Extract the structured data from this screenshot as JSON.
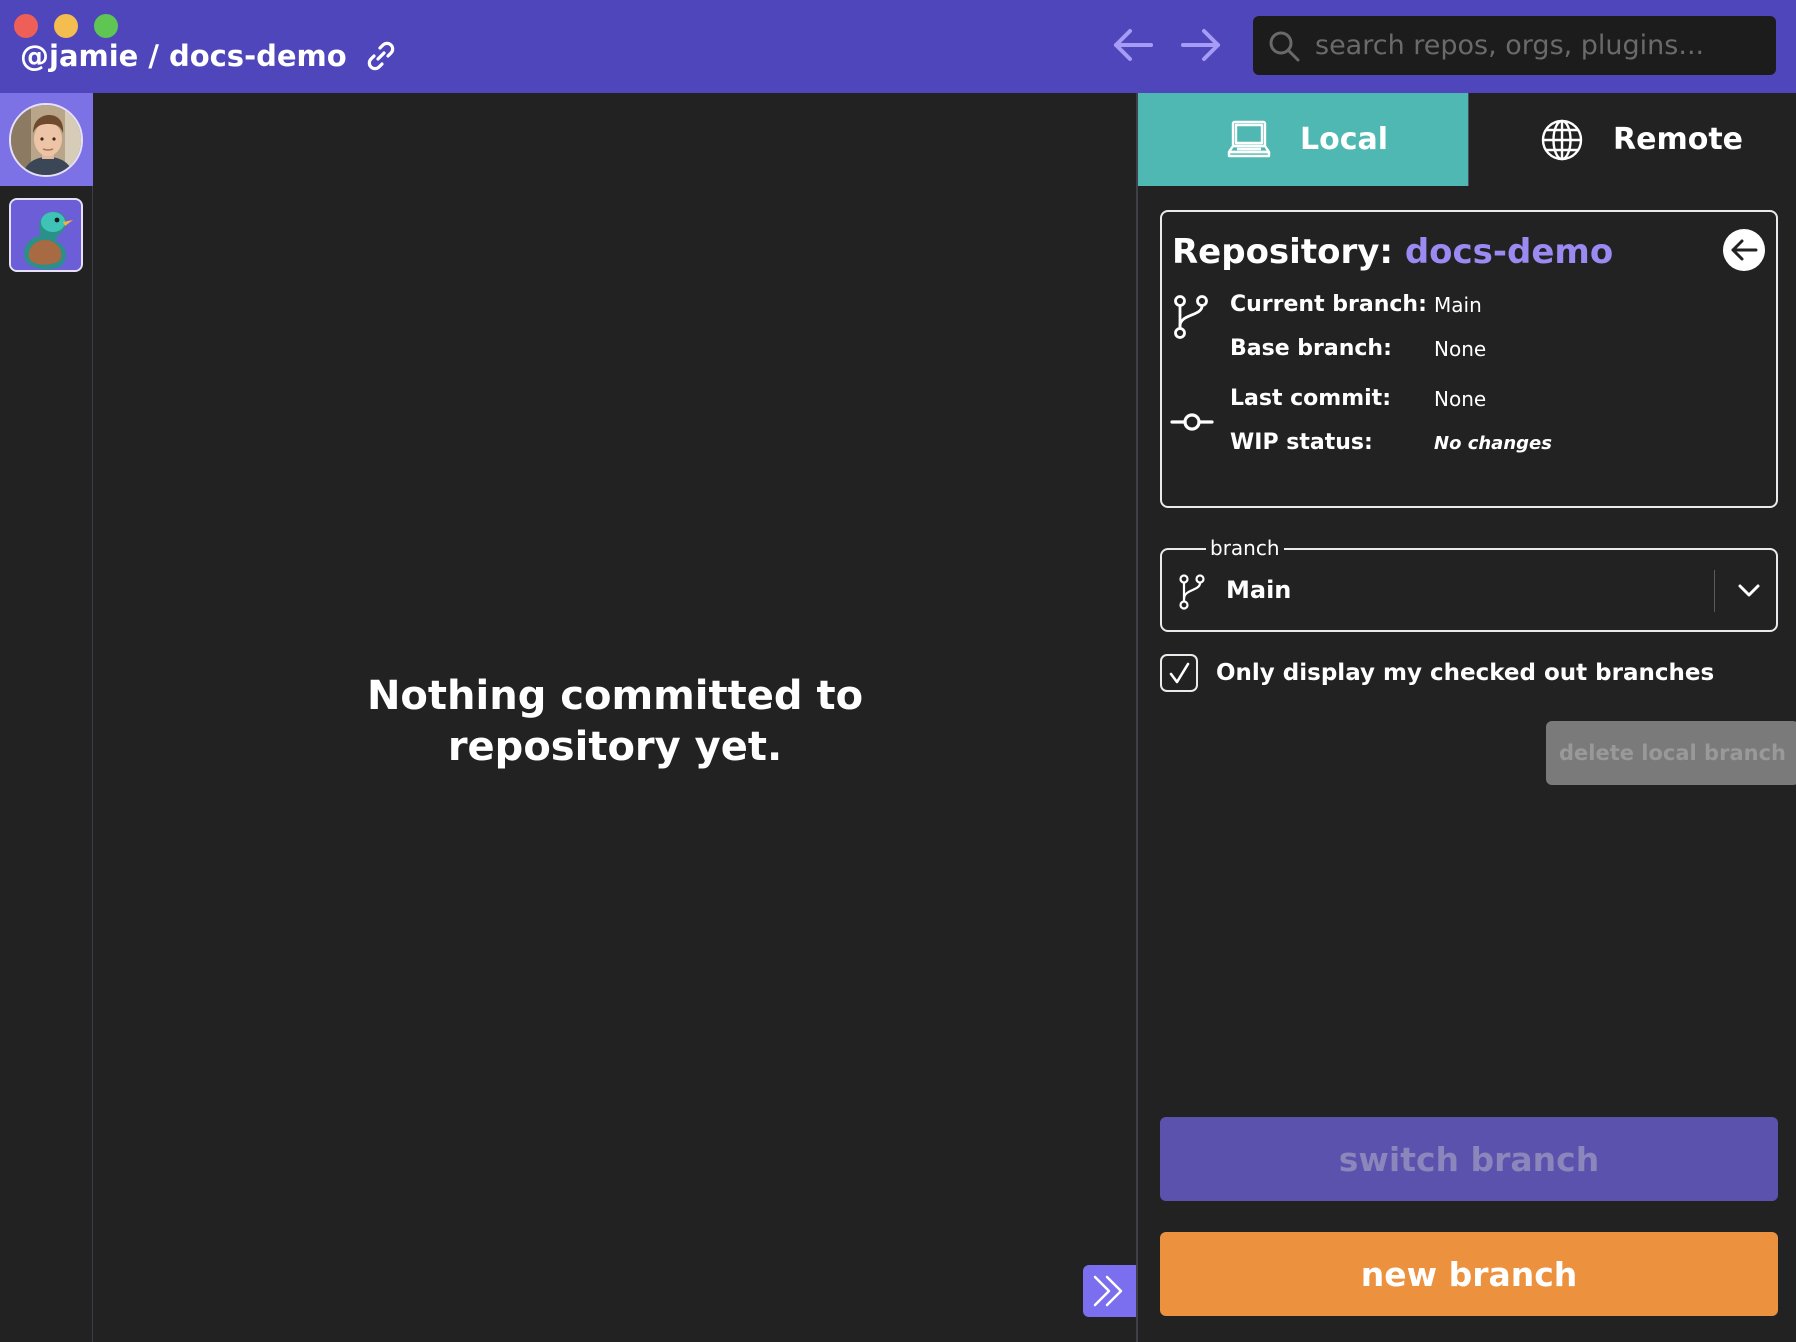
{
  "titlebar": {
    "owner": "@jamie",
    "separator": "/",
    "repo": "docs-demo"
  },
  "search": {
    "placeholder": "search repos, orgs, plugins..."
  },
  "main": {
    "empty_message_line1": "Nothing committed to",
    "empty_message_line2": "repository yet."
  },
  "tabs": [
    {
      "label": "Local",
      "icon": "laptop-icon",
      "active": true
    },
    {
      "label": "Remote",
      "icon": "globe-icon",
      "active": false
    }
  ],
  "repo_card": {
    "title_label": "Repository:",
    "repo_name": "docs-demo",
    "rows": [
      {
        "key": "Current branch:",
        "value": "Main"
      },
      {
        "key": "Base branch:",
        "value": "None"
      },
      {
        "key": "Last commit:",
        "value": "None"
      },
      {
        "key": "WIP status:",
        "value": "No changes"
      }
    ]
  },
  "branch_select": {
    "legend": "branch",
    "value": "Main"
  },
  "checkbox": {
    "label": "Only display my checked out branches",
    "checked": true
  },
  "buttons": {
    "delete_local": "delete local branch",
    "switch_branch": "switch branch",
    "new_branch": "new branch"
  },
  "colors": {
    "titlebar": "#5046bc",
    "accent_purple": "#9a8af2",
    "local_tab": "#4fb8b3",
    "new_branch": "#ec913e",
    "switch_branch": "#5a52ad",
    "background": "#222222"
  }
}
